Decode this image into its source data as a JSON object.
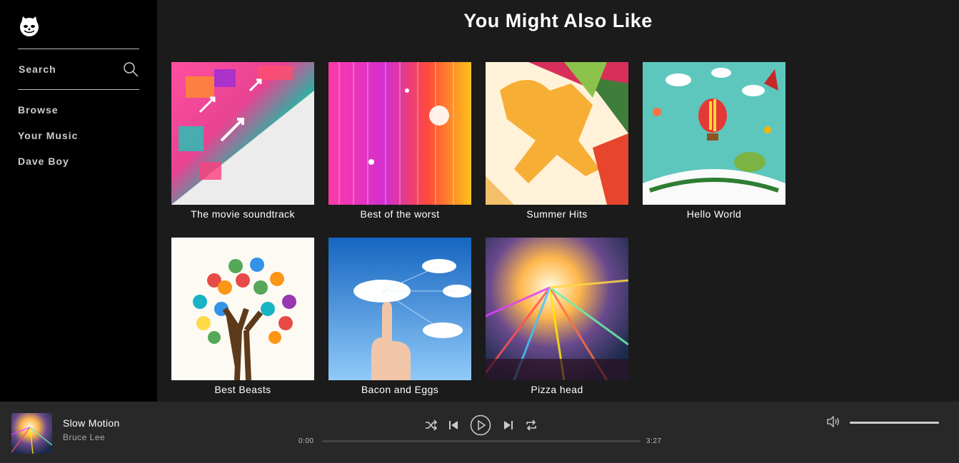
{
  "sidebar": {
    "logo_icon": "cat-face-icon",
    "search_label": "Search",
    "nav": [
      {
        "label": "Browse"
      },
      {
        "label": "Your Music"
      },
      {
        "label": "Dave Boy"
      }
    ]
  },
  "main": {
    "title": "You Might Also Like",
    "albums": [
      {
        "title": "The movie soundtrack"
      },
      {
        "title": "Best of the worst"
      },
      {
        "title": "Summer Hits"
      },
      {
        "title": "Hello World"
      },
      {
        "title": "Best Beasts"
      },
      {
        "title": "Bacon and Eggs"
      },
      {
        "title": "Pizza head"
      }
    ]
  },
  "player": {
    "track": "Slow Motion",
    "artist": "Bruce Lee",
    "current_time": "0:00",
    "duration": "3:27",
    "progress": 0,
    "volume": 1.0,
    "controls": [
      "shuffle-icon",
      "previous-icon",
      "play-icon",
      "next-icon",
      "repeat-icon"
    ]
  },
  "colors": {
    "sidebar_bg": "#000000",
    "main_bg": "#1b1b1b",
    "player_bg": "#282828"
  }
}
